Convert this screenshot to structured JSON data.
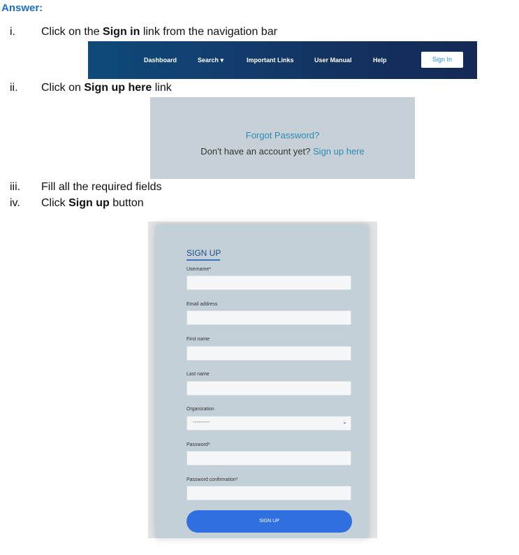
{
  "answer_label": "Answer:",
  "steps": [
    {
      "num": "i.",
      "pre": "Click on the ",
      "bold": "Sign in",
      "post": " link from the navigation bar"
    },
    {
      "num": "ii.",
      "pre": "Click on ",
      "bold": "Sign up here",
      "post": " link"
    },
    {
      "num": "iii.",
      "text": "Fill all the required fields"
    },
    {
      "num": "iv.",
      "pre": "Click ",
      "bold": "Sign up",
      "post": " button"
    }
  ],
  "navbar": {
    "items": [
      "Dashboard",
      "Search ▾",
      "Important Links",
      "User Manual",
      "Help"
    ],
    "signin_label": "Sign In"
  },
  "forgot": {
    "forgot_label": "Forgot Password?",
    "no_account_text": "Don't have an account yet?",
    "signup_link": "Sign up here"
  },
  "signup_form": {
    "title": "SIGN UP",
    "fields": [
      {
        "label": "Username*"
      },
      {
        "label": "Email address"
      },
      {
        "label": "First name"
      },
      {
        "label": "Last name"
      },
      {
        "label": "Organization",
        "value": "---------"
      },
      {
        "label": "Password*"
      },
      {
        "label": "Password confirmation*"
      }
    ],
    "button_label": "SIGN UP"
  },
  "colors": {
    "accent": "#2f6fe0",
    "heading": "#1f6fb8",
    "link": "#2a8bb5",
    "navbar": "#13305e"
  }
}
